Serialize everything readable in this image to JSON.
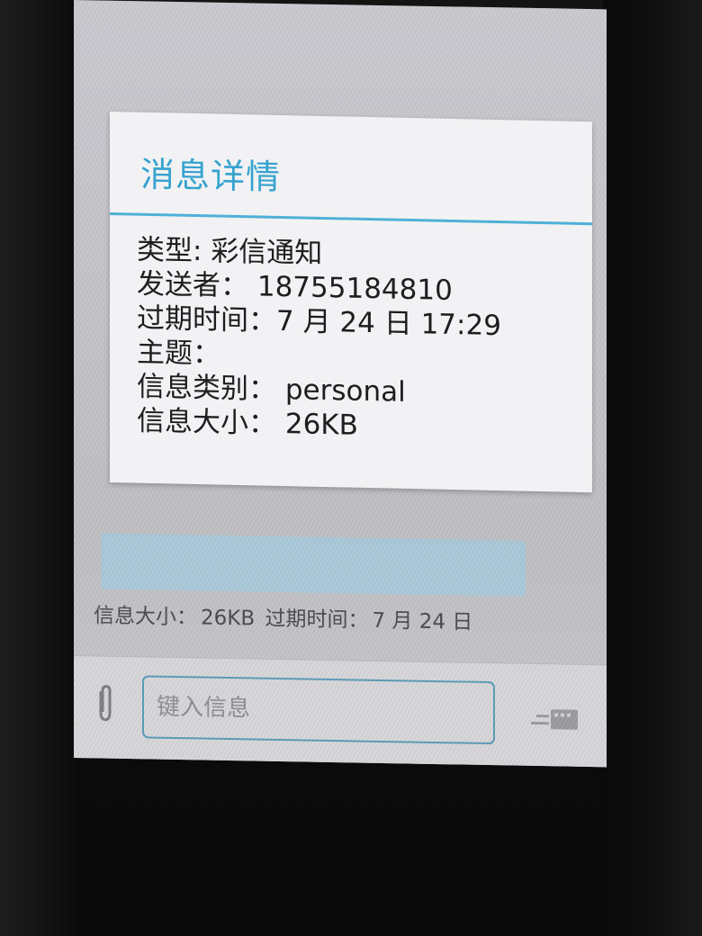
{
  "dialog": {
    "title": "消息详情",
    "rows": [
      {
        "label": "类型",
        "sep": ": ",
        "value": "彩信通知"
      },
      {
        "label": "发送者",
        "sep": "： ",
        "value": "18755184810"
      },
      {
        "label": "过期时间",
        "sep": "：",
        "value": "7 月 24 日 17:29"
      },
      {
        "label": "主题",
        "sep": "：",
        "value": ""
      },
      {
        "label": "信息类别",
        "sep": "： ",
        "value": "personal"
      },
      {
        "label": "信息大小",
        "sep": "： ",
        "value": "26KB"
      }
    ]
  },
  "message_bubble": {
    "size_label": "信息大小：",
    "size_value": "26KB",
    "expiry_label": "过期时间：",
    "expiry_value": "7 月 24 日"
  },
  "compose": {
    "placeholder": "键入信息",
    "attach_icon": "paperclip-icon",
    "send_icon": "send-mms-icon"
  },
  "colors": {
    "accent": "#36a3cf",
    "bubble": "#a9c8d8"
  }
}
